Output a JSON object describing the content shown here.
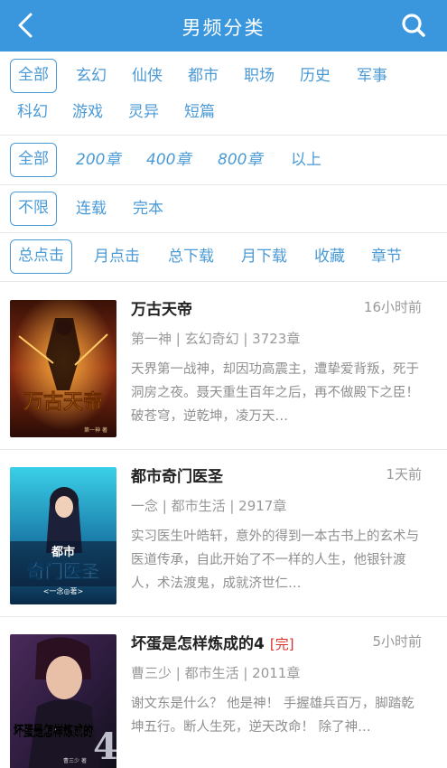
{
  "header": {
    "title": "男频分类"
  },
  "filters": {
    "category": [
      "全部",
      "玄幻",
      "仙侠",
      "都市",
      "职场",
      "历史",
      "军事",
      "科幻",
      "游戏",
      "灵异",
      "短篇"
    ],
    "chapters": [
      "全部",
      "200章",
      "400章",
      "800章",
      "以上"
    ],
    "status": [
      "不限",
      "连载",
      "完本"
    ],
    "sort": [
      "总点击",
      "月点击",
      "总下载",
      "月下载",
      "收藏",
      "章节"
    ]
  },
  "books": [
    {
      "title": "万古天帝",
      "time": "16小时前",
      "meta": "第一神 | 玄幻奇幻 | 3723章",
      "desc": "天界第一战神，却因功高震主，遭挚爱背叛，死于洞房之夜。聂天重生百年之后，再不做殿下之臣！破苍穹，逆乾坤，凌万天…",
      "cover_text": "万古天帝",
      "cover_author": "第一神 著"
    },
    {
      "title": "都市奇门医圣",
      "time": "1天前",
      "meta": "一念 | 都市生活 | 2917章",
      "desc": "实习医生叶皓轩，意外的得到一本古书上的玄术与医道传承，自此开始了不一样的人生，他银针渡人，术法渡鬼，成就济世仁…",
      "cover_text_top": "都市",
      "cover_text_main": "奇门医圣",
      "cover_author": "<一念◎著>"
    },
    {
      "title": "坏蛋是怎样炼成的4",
      "done": "[完]",
      "time": "5小时前",
      "meta": "曹三少 | 都市生活 | 2011章",
      "desc": "谢文东是什么？ 他是神！ 手握雄兵百万，脚踏乾坤五行。断人生死，逆天改命！ 除了神…",
      "cover_text": "坏蛋是怎样炼成的",
      "cover_num": "4",
      "cover_author": "曹三少 著"
    }
  ]
}
